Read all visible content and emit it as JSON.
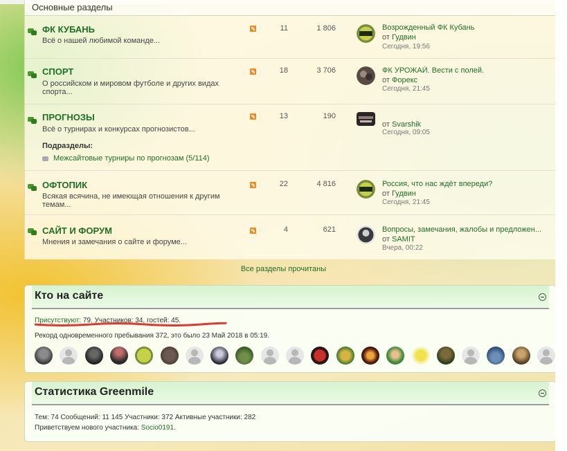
{
  "section": {
    "title": "Основные разделы"
  },
  "forums": [
    {
      "title": "ФК КУБАНЬ",
      "desc": "Всё о нашей любимой команде...",
      "topics": "11",
      "posts": "1 806",
      "last": {
        "title": "Возрожденный ФК Кубань",
        "by_prefix": "от",
        "by": "Гудвин",
        "time": "Сегодня, 19:56"
      }
    },
    {
      "title": "СПОРТ",
      "desc": "О российском и мировом футболе и других видах спорта...",
      "topics": "18",
      "posts": "3 706",
      "last": {
        "title": "ФК УРОЖАЙ. Вести с полей.",
        "by_prefix": "от",
        "by": "Форекс",
        "time": "Сегодня, 21:45"
      }
    },
    {
      "title": "ПРОГНОЗЫ",
      "desc": "Всё о турнирах и конкурсах прогнозистов...",
      "topics": "13",
      "posts": "190",
      "subforums_label": "Подразделы:",
      "subforum": "Межсайтовые турниры по прогнозам (5/114)",
      "last": {
        "title": "",
        "by_prefix": "от",
        "by": "Svarshik",
        "time": "Сегодня, 09:05"
      }
    },
    {
      "title": "ОФТОПИК",
      "desc": "Всякая всячина, не имеющая отношения к другим темам...",
      "topics": "22",
      "posts": "4 816",
      "last": {
        "title": "Россия, что нас ждёт впереди?",
        "by_prefix": "от",
        "by": "Гудвин",
        "time": "Сегодня, 21:45"
      }
    },
    {
      "title": "САЙТ И ФОРУМ",
      "desc": "Мнения и замечания о сайте и форуме...",
      "topics": "4",
      "posts": "621",
      "last": {
        "title": "Вопросы, замечания, жалобы и предложен...",
        "by_prefix": "от",
        "by": "SAMIT",
        "time": "Вчера, 00:22"
      }
    }
  ],
  "all_read": "Все разделы прочитаны",
  "online": {
    "title": "Кто на сайте",
    "present_label": "Присутствуют",
    "present_rest": ": 79. Участников: 34, гостей: 45.",
    "record": "Рекорд одновременного пребывания 372, это было 23 Май 2018 в 05:19.",
    "avatar_count": 21
  },
  "stats": {
    "title": "Статистика Greenmile",
    "line1": "Тем: 74   Сообщений: 11 145   Участники: 372   Активные участники: 282",
    "welcome_prefix": "Приветствуем нового участника: ",
    "new_member": "Socio0191",
    "welcome_suffix": "."
  },
  "colors": {
    "link_green": "#1f6e2a",
    "accent_orange": "#f08a24",
    "underline_red": "#e0382f"
  },
  "icons": [
    "chat-bubbles-icon",
    "rss-icon",
    "collapse-icon",
    "subforum-icon"
  ]
}
